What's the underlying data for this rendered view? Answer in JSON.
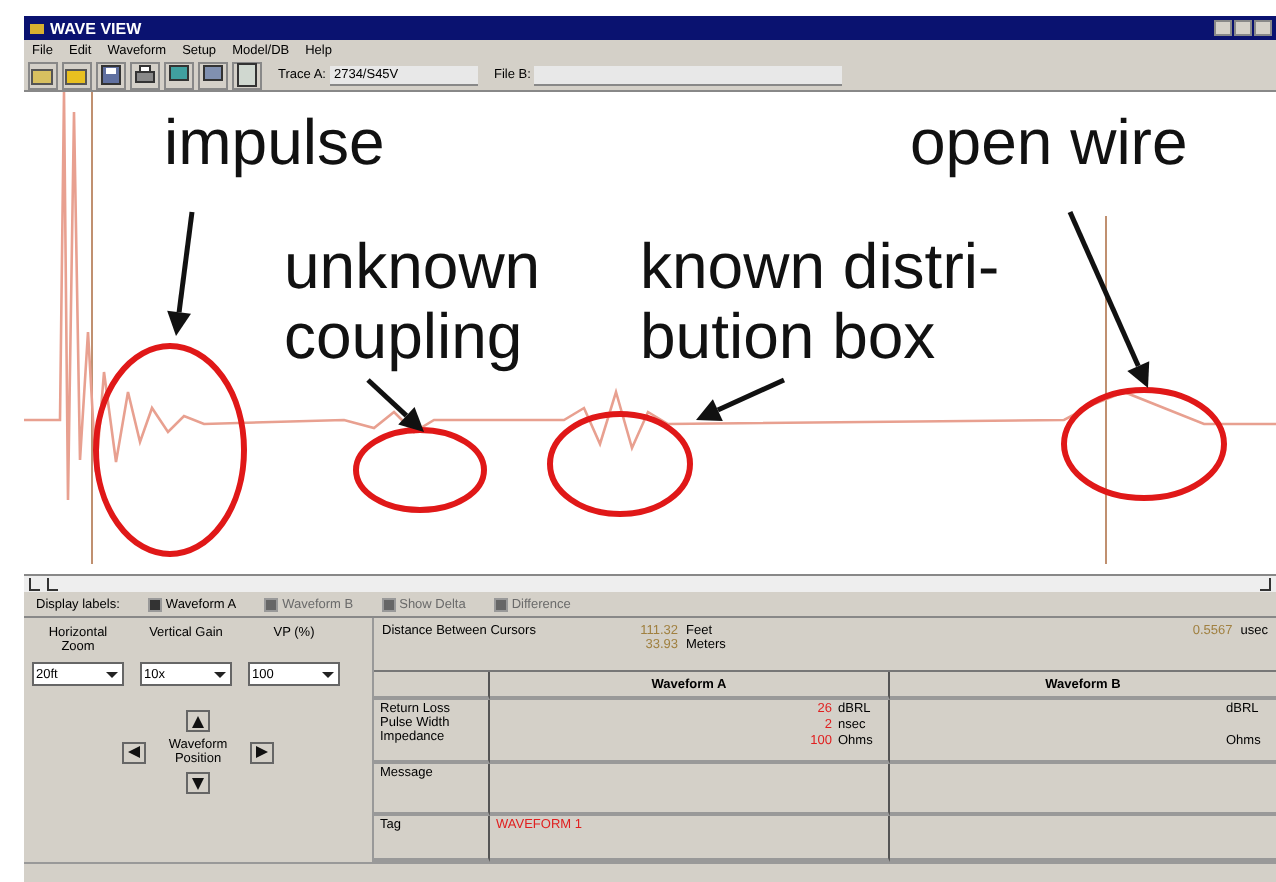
{
  "window": {
    "title": "WAVE VIEW"
  },
  "menu": [
    "File",
    "Edit",
    "Waveform",
    "Setup",
    "Model/DB",
    "Help"
  ],
  "toolbar": {
    "trace_a_label": "Trace A:",
    "trace_a_value": "2734/S45V",
    "file_b_label": "File B:"
  },
  "annotations": [
    {
      "lines": [
        "impulse"
      ]
    },
    {
      "lines": [
        "unknown",
        "coupling"
      ]
    },
    {
      "lines": [
        "known distri-",
        "bution box"
      ]
    },
    {
      "lines": [
        "open wire"
      ]
    }
  ],
  "display_labels": {
    "label": "Display labels:",
    "options": [
      {
        "label": "Waveform A",
        "checked": true,
        "disabled": false
      },
      {
        "label": "Waveform B",
        "checked": true,
        "disabled": true
      },
      {
        "label": "Show Delta",
        "checked": true,
        "disabled": true
      },
      {
        "label": "Difference",
        "checked": true,
        "disabled": true
      }
    ]
  },
  "controls": [
    {
      "label": "Horizontal Zoom",
      "value": "20ft"
    },
    {
      "label": "Vertical Gain",
      "value": "10x"
    },
    {
      "label": "VP (%)",
      "value": "100"
    }
  ],
  "position": {
    "label": "Waveform Position"
  },
  "distance": {
    "label": "Distance Between Cursors",
    "feet": "111.32",
    "feet_unit": "Feet",
    "meters": "33.93",
    "meters_unit": "Meters",
    "time": "0.5567",
    "time_unit": "usec"
  },
  "table": {
    "columns": [
      "Waveform A",
      "Waveform B"
    ],
    "params": [
      {
        "label": "Return Loss",
        "a_value": "26",
        "a_unit": "dBRL",
        "b_unit": "dBRL"
      },
      {
        "label": "Pulse Width",
        "a_value": "2",
        "a_unit": "nsec"
      },
      {
        "label": "Impedance",
        "a_value": "100",
        "a_unit": "Ohms",
        "b_unit": "Ohms"
      }
    ],
    "message_label": "Message",
    "tag_label": "Tag",
    "tag_value": "WAVEFORM 1"
  }
}
